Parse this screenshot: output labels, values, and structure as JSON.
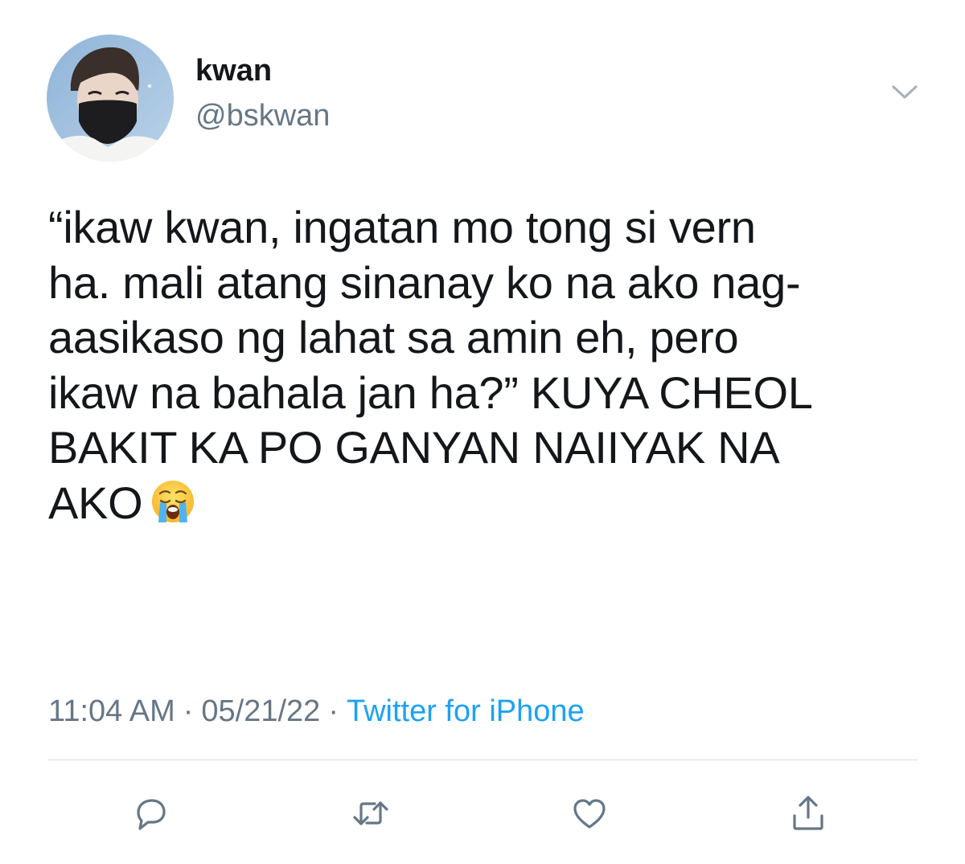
{
  "author": {
    "display_name": "kwan",
    "handle": "@bskwan",
    "avatar_icon": "profile-photo"
  },
  "tweet": {
    "lines": [
      "“ikaw kwan, ingatan mo tong si vern",
      "ha. mali atang sinanay ko na ako nag-",
      "aasikaso ng lahat sa amin eh, pero",
      "ikaw na bahala jan ha?” KUYA CHEOL",
      "BAKIT KA PO GANYAN NAIIYAK NA",
      "AKO"
    ],
    "emoji": "loudly-crying-face"
  },
  "meta": {
    "time": "11:04 AM",
    "separator": "·",
    "date": "05/21/22",
    "source": "Twitter for iPhone"
  },
  "actions": {
    "reply_icon": "reply-icon",
    "retweet_icon": "retweet-icon",
    "like_icon": "heart-icon",
    "share_icon": "share-icon"
  },
  "colors": {
    "text": "#14171a",
    "secondary": "#657786",
    "link": "#1da1f2",
    "divider": "#d7dce0"
  }
}
